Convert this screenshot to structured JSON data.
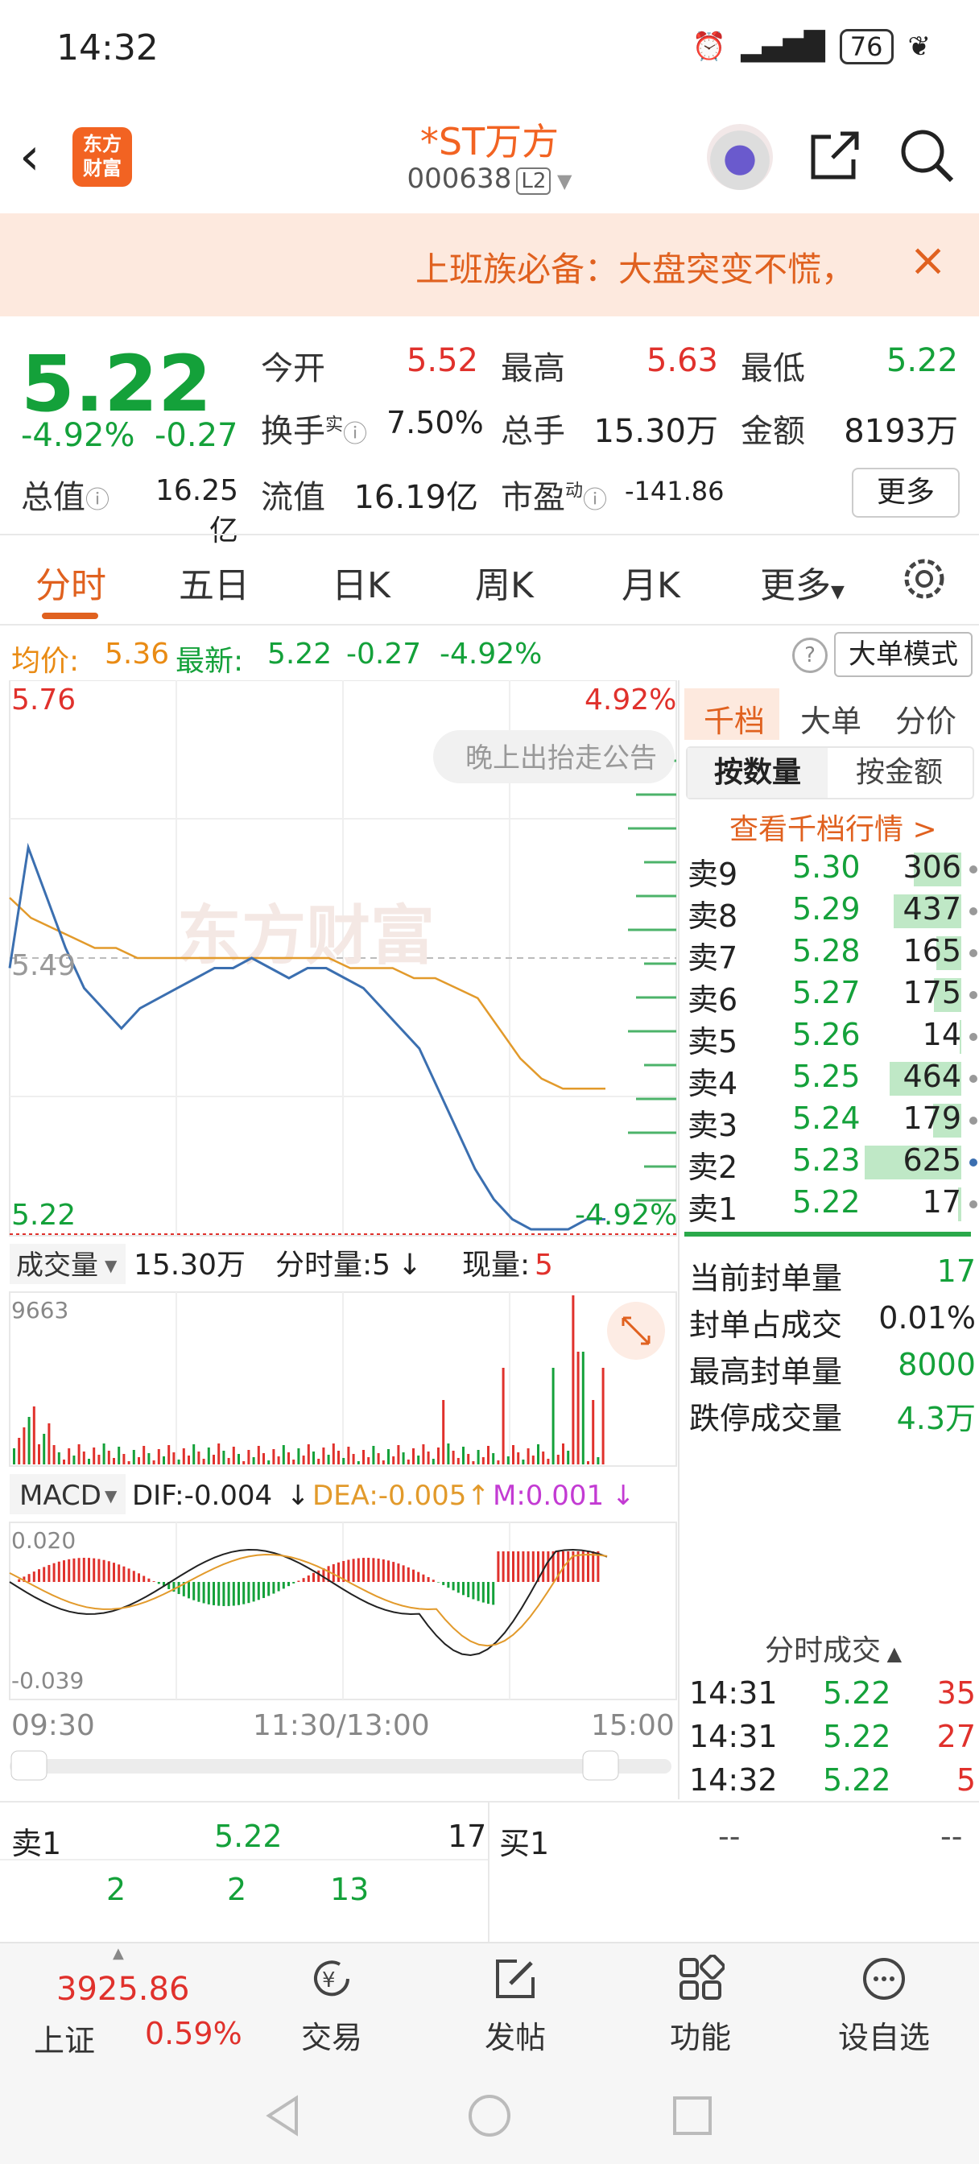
{
  "status_bar": {
    "time": "14:32",
    "battery": "76"
  },
  "header": {
    "title": "*ST万方",
    "code": "000638",
    "level": "L2",
    "logo_line1": "东方",
    "logo_line2": "财富"
  },
  "banner": {
    "text": "上班族必备：大盘突变不慌，",
    "close": "×"
  },
  "quote": {
    "price": "5.22",
    "change_pct": "-4.92%",
    "change": "-0.27",
    "open_label": "今开",
    "open": "5.52",
    "high_label": "最高",
    "high": "5.63",
    "low_label": "最低",
    "low": "5.22",
    "turnover_label": "换手",
    "turnover_sup": "实",
    "turnover": "7.50%",
    "volume_label": "总手",
    "volume": "15.30万",
    "amount_label": "金额",
    "amount": "8193万",
    "mktcap_label": "总值",
    "mktcap": "16.25亿",
    "float_label": "流值",
    "float": "16.19亿",
    "pe_label": "市盈",
    "pe_sup": "动",
    "pe": "-141.86",
    "more": "更多"
  },
  "tabs": [
    "分时",
    "五日",
    "日K",
    "周K",
    "月K",
    "更多"
  ],
  "avg": {
    "avg_label": "均价:",
    "avg": "5.36",
    "latest_label": "最新:",
    "latest": "5.22",
    "change": "-0.27",
    "pct": "-4.92%",
    "mode_button": "大单模式"
  },
  "chart_data": {
    "type": "line",
    "title": "",
    "top_price": "5.76",
    "top_pct": "4.92%",
    "bottom_price": "5.22",
    "bottom_pct": "-4.92%",
    "mid_price": "5.49",
    "x_labels": [
      "09:30",
      "11:30/13:00",
      "15:00"
    ],
    "overlay_text": "晚上出抬走公告",
    "watermark": "东方财富",
    "ylim": [
      5.22,
      5.76
    ],
    "series": [
      {
        "values": [
          5.48,
          5.6,
          5.55,
          5.5,
          5.46,
          5.44,
          5.42,
          5.44,
          5.45,
          5.46,
          5.47,
          5.48,
          5.48,
          5.49,
          5.48,
          5.47,
          5.48,
          5.48,
          5.47,
          5.46,
          5.44,
          5.42,
          5.4,
          5.36,
          5.32,
          5.28,
          5.25,
          5.23,
          5.22,
          5.22,
          5.22,
          5.23,
          5.23
        ]
      },
      {
        "values": [
          5.55,
          5.53,
          5.52,
          5.51,
          5.5,
          5.5,
          5.49,
          5.49,
          5.49,
          5.49,
          5.49,
          5.49,
          5.49,
          5.49,
          5.49,
          5.49,
          5.48,
          5.48,
          5.48,
          5.47,
          5.47,
          5.46,
          5.45,
          5.42,
          5.39,
          5.37,
          5.36,
          5.36,
          5.36
        ]
      }
    ],
    "volume": {
      "label": "成交量",
      "total": "15.30万",
      "unit_label": "分时量:5",
      "now_label": "现量:",
      "now": "5",
      "max": "9663"
    },
    "macd": {
      "label": "MACD",
      "dif": "DIF:-0.004",
      "dea": "DEA:-0.005",
      "m": "M:0.001",
      "top": "0.020",
      "bottom": "-0.039"
    }
  },
  "book": {
    "tabs": [
      "千档",
      "大单",
      "分价"
    ],
    "subtabs": [
      "按数量",
      "按金额"
    ],
    "link": "查看千档行情 >",
    "asks": [
      {
        "name": "卖9",
        "price": "5.30",
        "vol": "306",
        "ratio": 0.49
      },
      {
        "name": "卖8",
        "price": "5.29",
        "vol": "437",
        "ratio": 0.7
      },
      {
        "name": "卖7",
        "price": "5.28",
        "vol": "165",
        "ratio": 0.26
      },
      {
        "name": "卖6",
        "price": "5.27",
        "vol": "175",
        "ratio": 0.28
      },
      {
        "name": "卖5",
        "price": "5.26",
        "vol": "14",
        "ratio": 0.02
      },
      {
        "name": "卖4",
        "price": "5.25",
        "vol": "464",
        "ratio": 0.74
      },
      {
        "name": "卖3",
        "price": "5.24",
        "vol": "179",
        "ratio": 0.29
      },
      {
        "name": "卖2",
        "price": "5.23",
        "vol": "625",
        "ratio": 1.0
      },
      {
        "name": "卖1",
        "price": "5.22",
        "vol": "17",
        "ratio": 0.03
      }
    ],
    "stats": [
      {
        "k": "当前封单量",
        "v": "17"
      },
      {
        "k": "封单占成交",
        "v": "0.01%"
      },
      {
        "k": "最高封单量",
        "v": "8000"
      },
      {
        "k": "跌停成交量",
        "v": "4.3万"
      }
    ],
    "ticks_title": "分时成交",
    "ticks": [
      {
        "t": "14:31",
        "p": "5.22",
        "v": "35"
      },
      {
        "t": "14:31",
        "p": "5.22",
        "v": "27"
      },
      {
        "t": "14:32",
        "p": "5.22",
        "v": "5"
      }
    ]
  },
  "level1": {
    "left_name": "卖1",
    "left_price": "5.22",
    "left_vol": "17",
    "right_name": "买1",
    "right_price": "--",
    "right_vol": "--",
    "queue": [
      "2",
      "2",
      "13"
    ]
  },
  "bottom_nav": {
    "index_value": "3925.86",
    "index_name": "上证",
    "index_pct": "0.59%",
    "items": [
      "交易",
      "发帖",
      "功能",
      "设自选"
    ]
  },
  "colors": {
    "up": "#e0312c",
    "down": "#14a13a",
    "accent": "#e0611f",
    "avg": "#e29a2b",
    "price_line": "#3b6fb0"
  }
}
